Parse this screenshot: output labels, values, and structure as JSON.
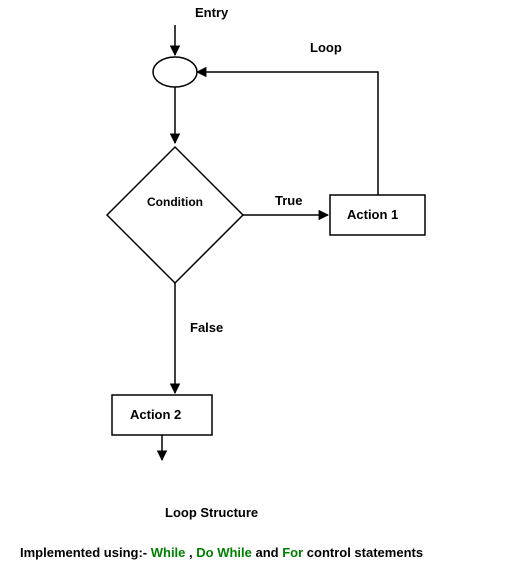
{
  "labels": {
    "entry": "Entry",
    "loop": "Loop",
    "condition": "Condition",
    "true": "True",
    "false": "False",
    "action1": "Action 1",
    "action2": "Action 2"
  },
  "caption": "Loop Structure",
  "footer": {
    "prefix": "Implemented using:- ",
    "while": "While",
    "sep1": " , ",
    "dowhile": "Do While",
    "sep2": " and ",
    "for": "For",
    "suffix": " control statements"
  },
  "chart_data": {
    "type": "diagram",
    "title": "Loop Structure",
    "nodes": [
      {
        "id": "entry",
        "type": "start",
        "label": "Entry"
      },
      {
        "id": "connector",
        "type": "connector"
      },
      {
        "id": "condition",
        "type": "decision",
        "label": "Condition"
      },
      {
        "id": "action1",
        "type": "process",
        "label": "Action 1"
      },
      {
        "id": "action2",
        "type": "process",
        "label": "Action 2"
      }
    ],
    "edges": [
      {
        "from": "entry",
        "to": "connector"
      },
      {
        "from": "connector",
        "to": "condition"
      },
      {
        "from": "condition",
        "to": "action1",
        "label": "True"
      },
      {
        "from": "action1",
        "to": "connector",
        "label": "Loop"
      },
      {
        "from": "condition",
        "to": "action2",
        "label": "False"
      }
    ],
    "annotations": [
      "Implemented using:- While , Do While and For control statements"
    ]
  }
}
